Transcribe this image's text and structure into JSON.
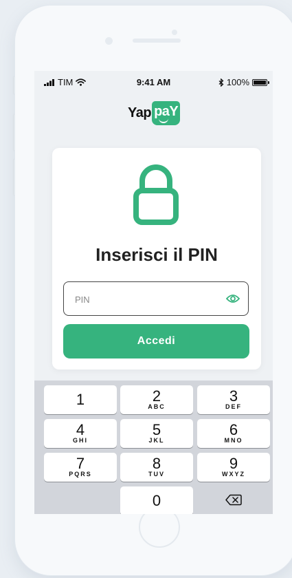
{
  "status_bar": {
    "carrier": "TIM",
    "time": "9:41 AM",
    "battery": "100%"
  },
  "brand": {
    "name_part1": "Yap",
    "name_part2": "paY",
    "color": "#36b37e"
  },
  "login": {
    "title": "Inserisci il PIN",
    "pin_placeholder": "PIN",
    "pin_value": "",
    "submit_label": "Accedi"
  },
  "keypad": {
    "keys": [
      {
        "num": "1",
        "letters": ""
      },
      {
        "num": "2",
        "letters": "ABC"
      },
      {
        "num": "3",
        "letters": "DEF"
      },
      {
        "num": "4",
        "letters": "GHI"
      },
      {
        "num": "5",
        "letters": "JKL"
      },
      {
        "num": "6",
        "letters": "MNO"
      },
      {
        "num": "7",
        "letters": "PQRS"
      },
      {
        "num": "8",
        "letters": "TUV"
      },
      {
        "num": "9",
        "letters": "WXYZ"
      },
      {
        "num": "0",
        "letters": ""
      }
    ],
    "delete_icon": "backspace-icon"
  },
  "icons": {
    "lock": "lock-icon",
    "eye": "eye-icon",
    "wifi": "wifi-icon",
    "bluetooth": "bluetooth-icon",
    "signal": "signal-bars-icon",
    "battery": "battery-icon"
  }
}
